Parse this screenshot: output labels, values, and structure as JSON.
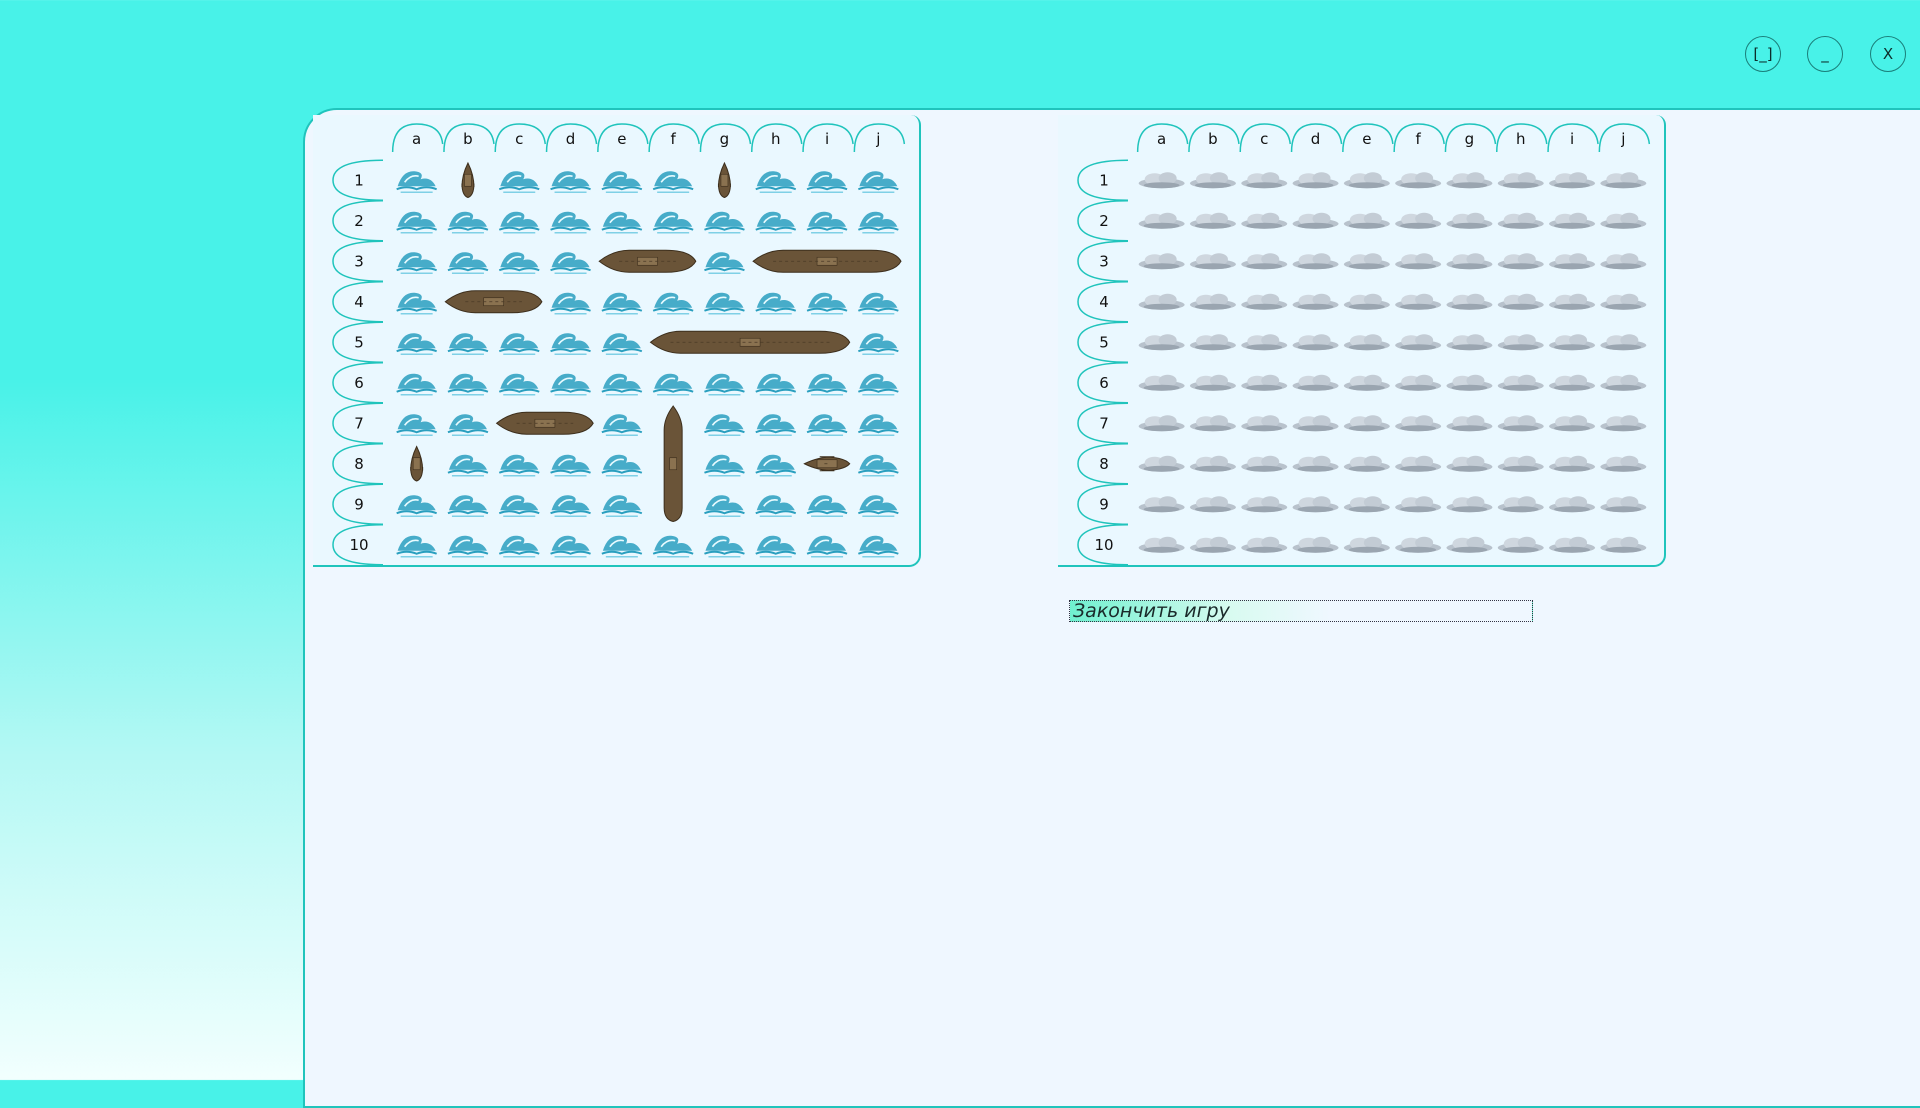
{
  "window_controls": {
    "maximize_label": "[_]",
    "minimize_label": "_",
    "close_label": "X"
  },
  "columns": [
    "a",
    "b",
    "c",
    "d",
    "e",
    "f",
    "g",
    "h",
    "i",
    "j"
  ],
  "rows": [
    "1",
    "2",
    "3",
    "4",
    "5",
    "6",
    "7",
    "8",
    "9",
    "10"
  ],
  "player_board": {
    "ships": [
      {
        "col": 1,
        "row": 0,
        "length": 1,
        "orientation": "vertical"
      },
      {
        "col": 6,
        "row": 0,
        "length": 1,
        "orientation": "vertical"
      },
      {
        "col": 4,
        "row": 2,
        "length": 2,
        "orientation": "horizontal"
      },
      {
        "col": 7,
        "row": 2,
        "length": 3,
        "orientation": "horizontal"
      },
      {
        "col": 1,
        "row": 3,
        "length": 2,
        "orientation": "horizontal"
      },
      {
        "col": 5,
        "row": 4,
        "length": 4,
        "orientation": "horizontal"
      },
      {
        "col": 2,
        "row": 6,
        "length": 2,
        "orientation": "horizontal"
      },
      {
        "col": 5,
        "row": 6,
        "length": 3,
        "orientation": "vertical"
      },
      {
        "col": 0,
        "row": 7,
        "length": 1,
        "orientation": "vertical"
      },
      {
        "col": 8,
        "row": 7,
        "length": 1,
        "orientation": "horizontal"
      }
    ],
    "cell_icon": "wave-icon"
  },
  "enemy_board": {
    "cell_icon": "cloud-icon"
  },
  "actions": {
    "finish_game_label": "Закончить игру"
  },
  "colors": {
    "background": "#48f2e8",
    "panel": "#eff7ff",
    "border": "#20c4bc",
    "wave": "#2a9fbf",
    "ship": "#6a5438",
    "cloud": "#b8c2cc"
  }
}
